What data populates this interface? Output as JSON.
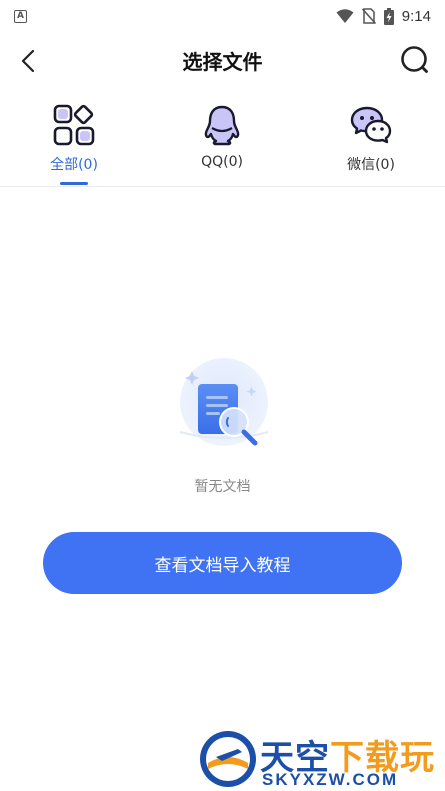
{
  "status_bar": {
    "app_badge": "A",
    "time": "9:14"
  },
  "header": {
    "title": "选择文件"
  },
  "tabs": [
    {
      "label": "全部(0)",
      "icon": "grid-icon",
      "active": true
    },
    {
      "label": "QQ(0)",
      "icon": "qq-penguin-icon",
      "active": false
    },
    {
      "label": "微信(0)",
      "icon": "wechat-icon",
      "active": false
    }
  ],
  "empty_state": {
    "message": "暂无文档",
    "button_label": "查看文档导入教程"
  },
  "watermark": {
    "text_main": "天空",
    "text_accent": "下载玩",
    "text_en": "SKYXZW.COM"
  },
  "colors": {
    "accent": "#3f73f3",
    "active_tab": "#2f6bd8",
    "watermark_blue": "#1c4fa8",
    "watermark_orange": "#f39b1c"
  }
}
